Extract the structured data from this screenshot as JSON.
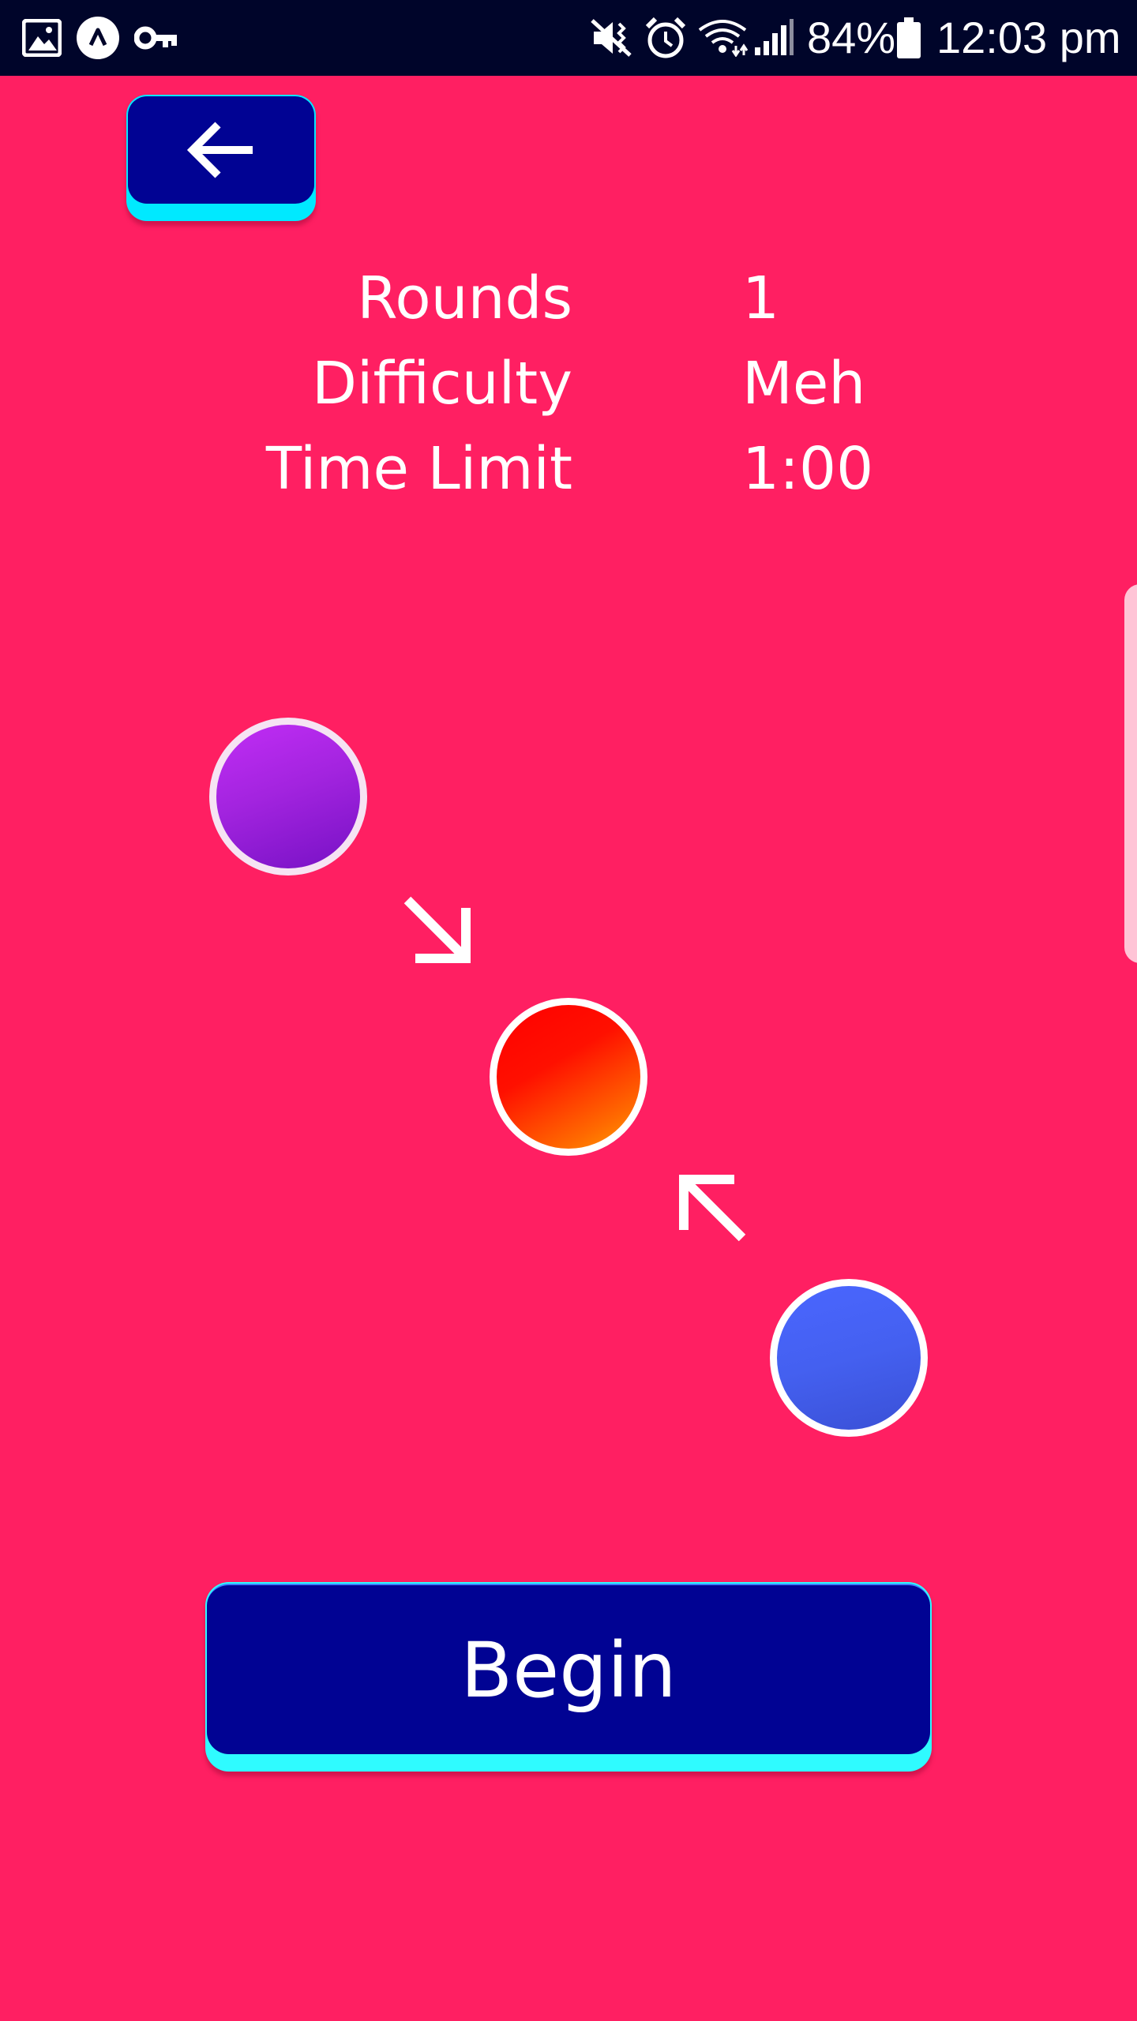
{
  "status_bar": {
    "battery_percent": "84%",
    "time": "12:03 pm",
    "icons": [
      "gallery-icon",
      "app-icon",
      "key-icon",
      "mute-vibrate-icon",
      "alarm-icon",
      "wifi-icon",
      "signal-icon",
      "battery-icon"
    ]
  },
  "header": {
    "back_icon": "back-arrow-icon"
  },
  "settings": {
    "rows": [
      {
        "label": "Rounds",
        "value": "1"
      },
      {
        "label": "Difficulty",
        "value": "Meh"
      },
      {
        "label": "Time Limit",
        "value": "1:00"
      }
    ]
  },
  "diagram": {
    "dots": [
      {
        "name": "purple-dot",
        "color": "#A324DF"
      },
      {
        "name": "red-dot",
        "color": "#FF2000"
      },
      {
        "name": "blue-dot",
        "color": "#4460F0"
      }
    ],
    "arrows": [
      "arrow-down-right-icon",
      "arrow-up-left-icon"
    ]
  },
  "actions": {
    "begin_label": "Begin"
  },
  "colors": {
    "background": "#FF1F62",
    "status_bar": "#00052A",
    "button_face": "#010393",
    "button_edge": "#2FFBFF"
  }
}
